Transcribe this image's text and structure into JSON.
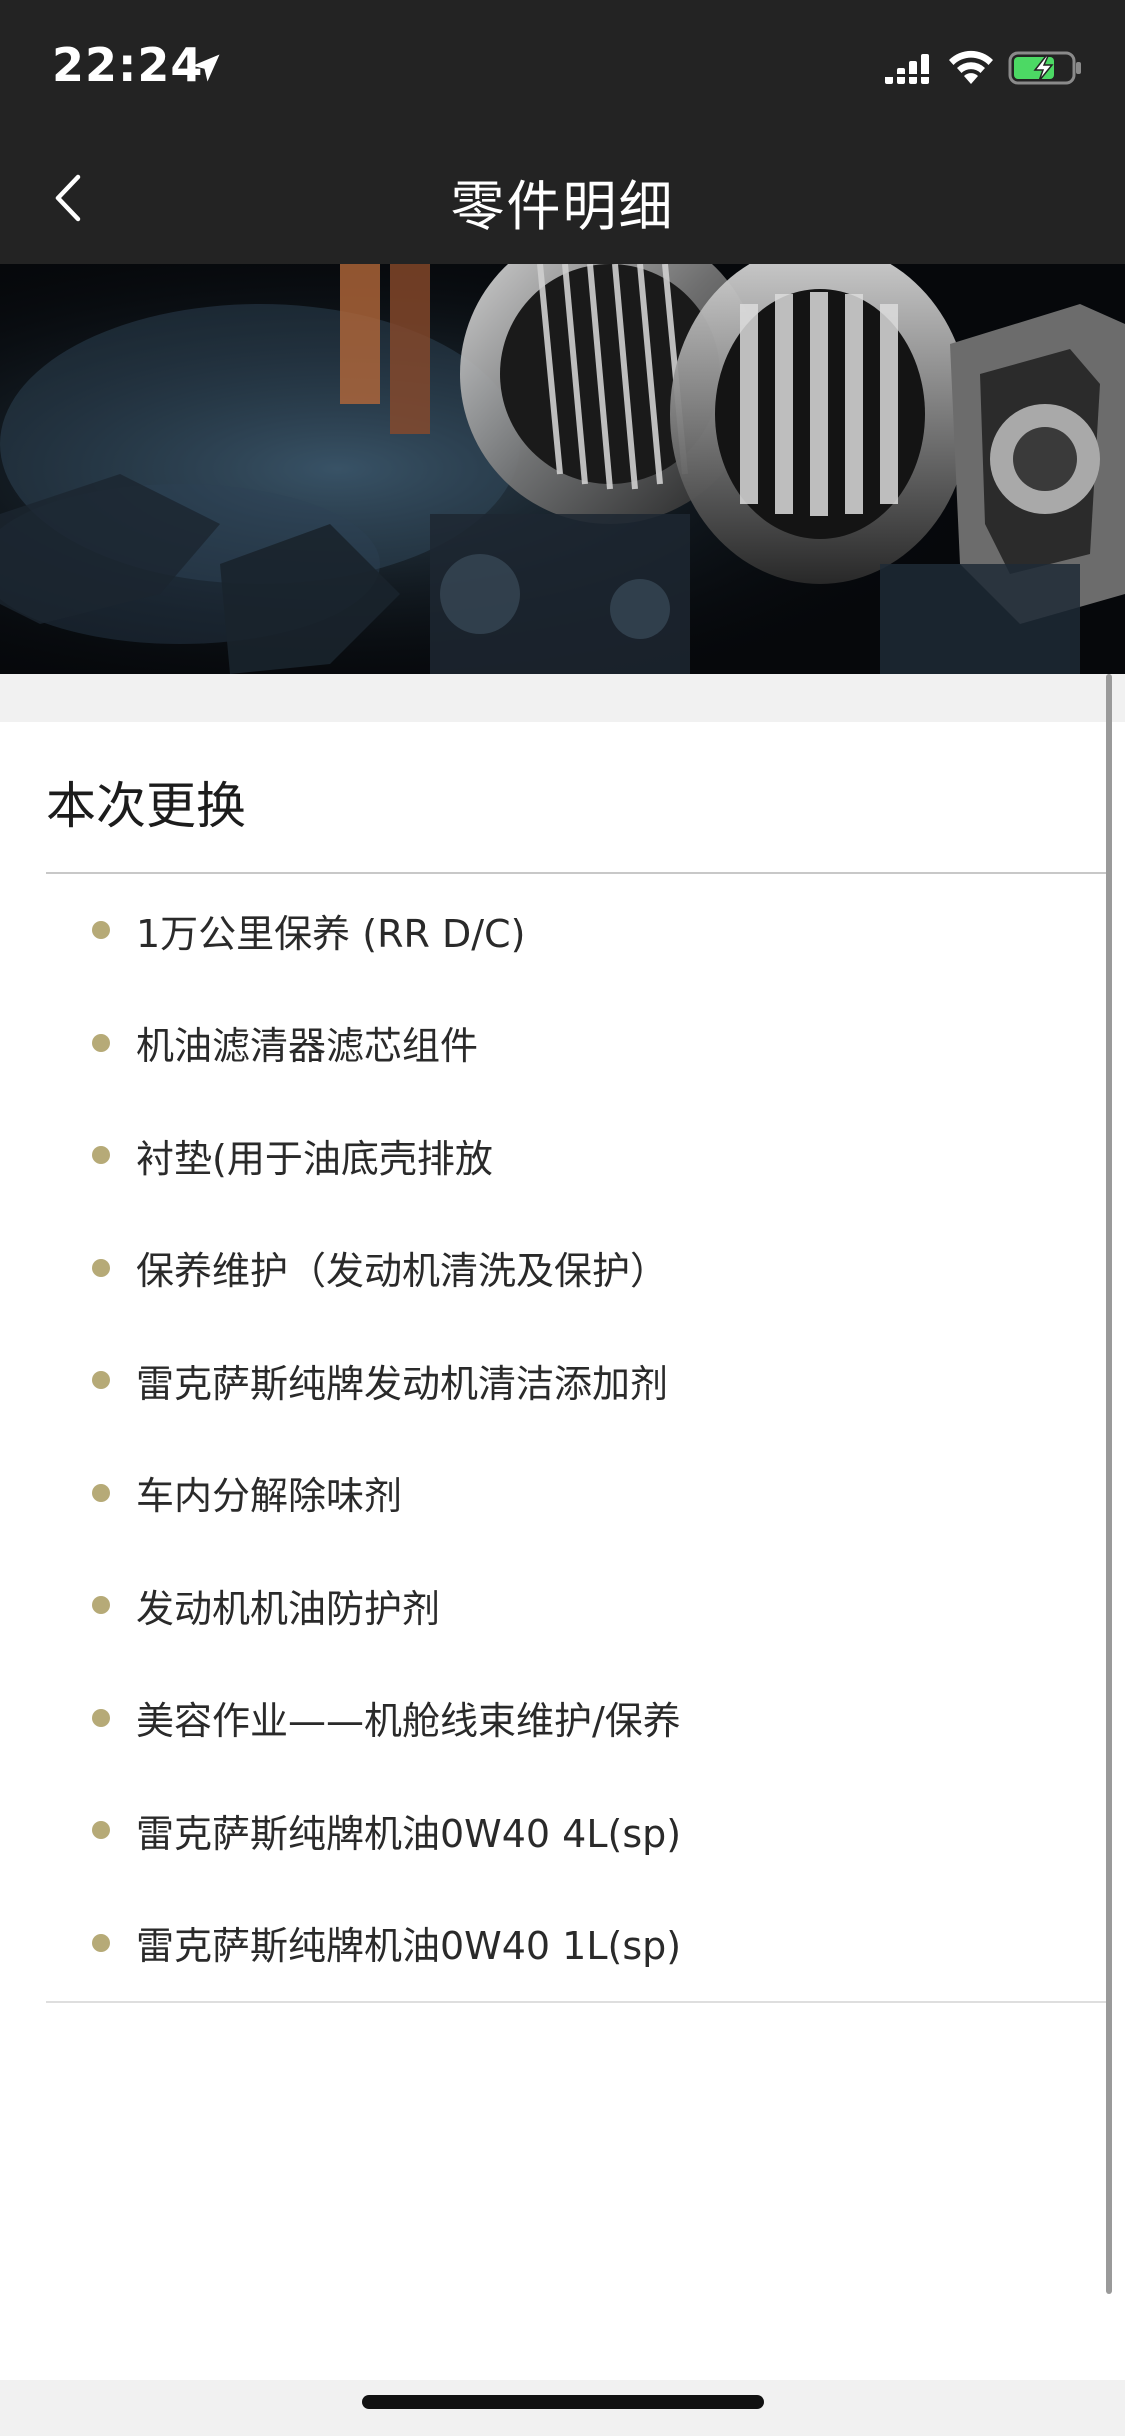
{
  "status_bar": {
    "time": "22:24"
  },
  "nav": {
    "title": "零件明细"
  },
  "section": {
    "title": "本次更换"
  },
  "parts": [
    "1万公里保养 (RR D/C)",
    "机油滤清器滤芯组件",
    "衬垫(用于油底壳排放",
    "保养维护（发动机清洗及保护）",
    "雷克萨斯纯牌发动机清洁添加剂",
    "车内分解除味剂",
    "发动机机油防护剂",
    "美容作业——机舱线束维护/保养",
    "雷克萨斯纯牌机油0W40 4L(sp)",
    "雷克萨斯纯牌机油0W40 1L(sp)"
  ],
  "colors": {
    "header_bg": "#232323",
    "bullet": "#b6aa77",
    "battery_charging": "#4cd964"
  },
  "icons": {
    "back": "chevron-left-icon",
    "location": "location-arrow-icon",
    "signal": "cellular-signal-icon",
    "wifi": "wifi-icon",
    "battery": "battery-charging-icon"
  }
}
